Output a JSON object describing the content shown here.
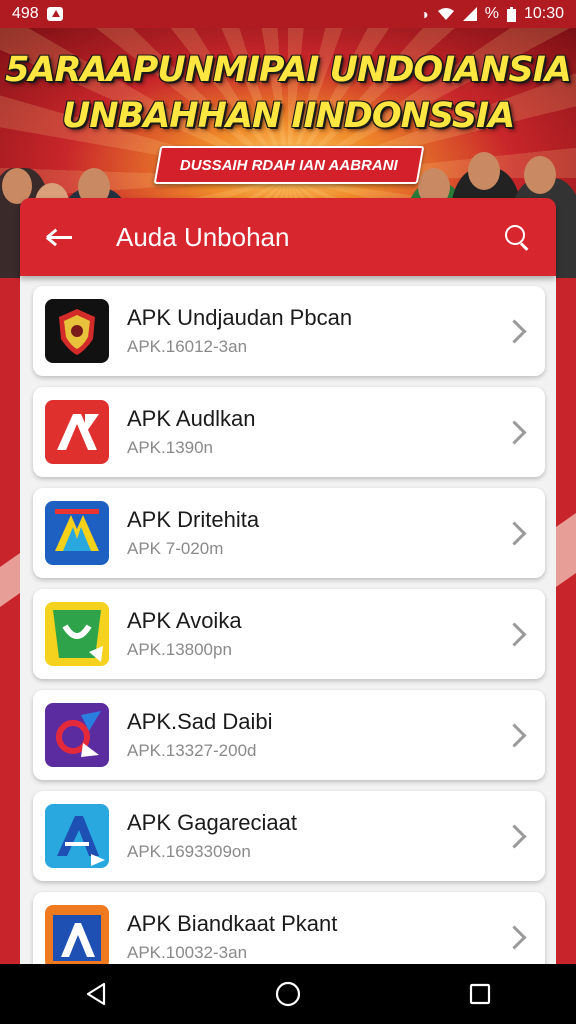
{
  "status_bar": {
    "left_text": "498",
    "right_percent": "%",
    "time": "10:30"
  },
  "banner": {
    "title_line1": "5ARAAPUNMIPAI UNDOIANSIA",
    "title_line2": "UNBAHHAN IINDONSSIA",
    "ribbon_text": "DUSSAIH RDAH IAN AABRANI"
  },
  "app_bar": {
    "title": "Auda Unbohan"
  },
  "apps": [
    {
      "name": "APK Undjaudan Pbcan",
      "sub": "APK.16012-3an",
      "icon": "emblem-shield-icon",
      "colors": [
        "#111111",
        "#d32a2a",
        "#e8c23a"
      ]
    },
    {
      "name": "APK Audlkan",
      "sub": "APK.1390n",
      "icon": "red-a-icon",
      "colors": [
        "#e0302e",
        "#ffffff"
      ]
    },
    {
      "name": "APK Dritehita",
      "sub": "APK 7-020m",
      "icon": "blue-book-icon",
      "colors": [
        "#1e5fc2",
        "#f6d11a",
        "#e33"
      ]
    },
    {
      "name": "APK Avoika",
      "sub": "APK.13800pn",
      "icon": "green-flag-icon",
      "colors": [
        "#f4d21d",
        "#2ea34a",
        "#ffffff"
      ]
    },
    {
      "name": "APK.Sad Daibi",
      "sub": "APK.13327-200d",
      "icon": "purple-star-icon",
      "colors": [
        "#5b2ba0",
        "#e42a3a",
        "#2a7ee0"
      ]
    },
    {
      "name": "APK Gagareciaat",
      "sub": "APK.1693309on",
      "icon": "cyan-a-icon",
      "colors": [
        "#29a8e0",
        "#1e4fb3",
        "#ffffff"
      ]
    },
    {
      "name": "APK Biandkaat Pkant",
      "sub": "APK.10032-3an",
      "icon": "orange-a-icon",
      "colors": [
        "#f07a20",
        "#1e4fb3",
        "#ffffff"
      ]
    }
  ]
}
